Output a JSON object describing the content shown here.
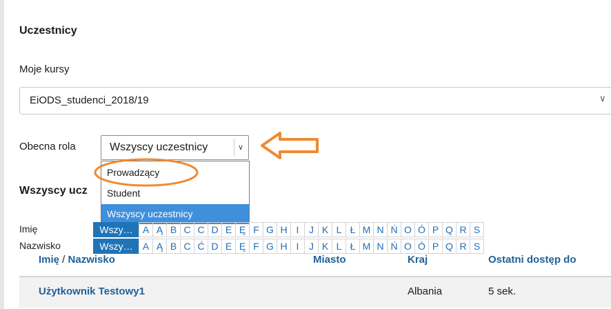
{
  "page": {
    "title": "Uczestnicy",
    "my_courses_label": "Moje kursy",
    "course_select_value": "EiODS_studenci_2018/19",
    "role_label": "Obecna rola",
    "role_select_value": "Wszyscy uczestnicy",
    "section_heading": "Wszyscy ucz"
  },
  "role_options": [
    "Prowadzący",
    "Student",
    "Wszyscy uczestnicy"
  ],
  "selected_role_index": 2,
  "filter": {
    "first_name_label": "Imię",
    "last_name_label": "Nazwisko",
    "all_label": "Wszy…",
    "letters": [
      "A",
      "Ą",
      "B",
      "C",
      "Ć",
      "D",
      "E",
      "Ę",
      "F",
      "G",
      "H",
      "I",
      "J",
      "K",
      "L",
      "Ł",
      "M",
      "N",
      "Ń",
      "O",
      "Ó",
      "P",
      "Q",
      "R",
      "S"
    ],
    "first_name_letters": [
      "A",
      "Ą",
      "B",
      "C",
      "C",
      "D",
      "E",
      "Ę",
      "F",
      "G",
      "H",
      "I",
      "J",
      "K",
      "L",
      "Ł",
      "M",
      "N",
      "Ń",
      "O",
      "Ó",
      "P",
      "Q",
      "R",
      "S"
    ]
  },
  "table": {
    "headers": {
      "name_first": "Imię",
      "name_sep": " / ",
      "name_last": "Nazwisko",
      "city": "Miasto",
      "country": "Kraj",
      "last_access": "Ostatni dostęp do"
    },
    "rows": [
      {
        "name": "Użytkownik Testowy1",
        "city": "",
        "country": "Albania",
        "last_access": "5 sek."
      }
    ]
  },
  "colors": {
    "accent": "#1f74b8",
    "annotation": "#f08a2e",
    "dropdown_selected": "#3f8fdc"
  }
}
